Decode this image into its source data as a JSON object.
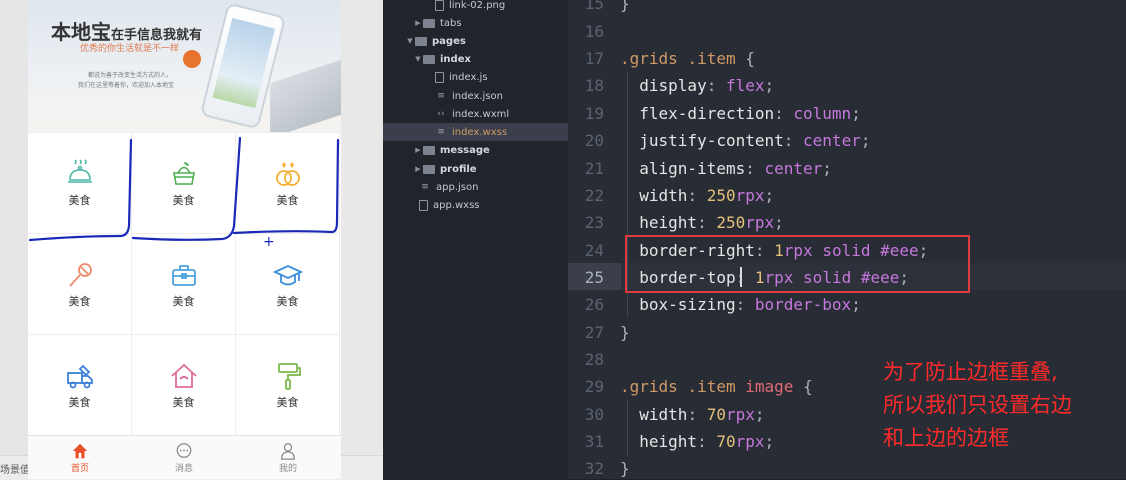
{
  "simulator": {
    "banner": {
      "title_big": "本地宝",
      "title_small": "在手信息我就有",
      "subtitle": "优秀的你生活就是不一样",
      "line1": "都说为善于改变生活方式的人，",
      "line2": "我们在这里等着你，欢迎加入本地宝"
    },
    "grid_items": [
      {
        "label": "美食",
        "icon": "food-cover-icon",
        "color": "#4fb7a8"
      },
      {
        "label": "美食",
        "icon": "basket-icon",
        "color": "#4caf50"
      },
      {
        "label": "美食",
        "icon": "rings-icon",
        "color": "#f2b134"
      },
      {
        "label": "美食",
        "icon": "microphone-icon",
        "color": "#f08a6a"
      },
      {
        "label": "美食",
        "icon": "briefcase-icon",
        "color": "#4aa3df"
      },
      {
        "label": "美食",
        "icon": "graduation-cap-icon",
        "color": "#3b8fd9"
      },
      {
        "label": "美食",
        "icon": "truck-icon",
        "color": "#3b7fd9"
      },
      {
        "label": "美食",
        "icon": "house-icon",
        "color": "#e46b9d"
      },
      {
        "label": "美食",
        "icon": "paint-roller-icon",
        "color": "#7bb84a"
      }
    ],
    "tabs": [
      {
        "label": "首页",
        "icon": "home-icon",
        "active": true
      },
      {
        "label": "消息",
        "icon": "message-icon",
        "active": false
      },
      {
        "label": "我的",
        "icon": "user-icon",
        "active": false
      }
    ],
    "status_text": "场景值",
    "annotation_mark": "+"
  },
  "file_tree": [
    {
      "name": "link-02.png",
      "type": "file-image"
    },
    {
      "name": "tabs",
      "type": "folder"
    },
    {
      "name": "pages",
      "type": "folder-open"
    },
    {
      "name": "index",
      "type": "folder-open"
    },
    {
      "name": "index.js",
      "type": "file-js"
    },
    {
      "name": "index.json",
      "type": "file-json"
    },
    {
      "name": "index.wxml",
      "type": "file-wxml"
    },
    {
      "name": "index.wxss",
      "type": "file-wxss",
      "selected": true
    },
    {
      "name": "message",
      "type": "folder"
    },
    {
      "name": "profile",
      "type": "folder"
    },
    {
      "name": "app.json",
      "type": "file-json"
    },
    {
      "name": "app.wxss",
      "type": "file"
    }
  ],
  "editor": {
    "line_numbers": [
      "15",
      "16",
      "17",
      "18",
      "19",
      "20",
      "21",
      "22",
      "23",
      "24",
      "25",
      "26",
      "27",
      "28",
      "29",
      "30",
      "31",
      "32"
    ],
    "current_line": "25",
    "tokens": {
      "l15": "}",
      "l17_sel1": ".grids",
      "l17_sel2": ".item",
      "l17_brace": "{",
      "l18_p": "display",
      "l18_v": "flex",
      "l19_p": "flex-direction",
      "l19_v": "column",
      "l20_p": "justify-content",
      "l20_v": "center",
      "l21_p": "align-items",
      "l21_v": "center",
      "l22_p": "width",
      "l22_n": "250",
      "l22_u": "rpx",
      "l23_p": "height",
      "l23_n": "250",
      "l23_u": "rpx",
      "l24_p": "border-right",
      "l24_n": "1",
      "l24_u": "rpx",
      "l24_v": "solid #eee",
      "l25_p": "border-top",
      "l25_n": "1",
      "l25_u": "rpx",
      "l25_v": "solid #eee",
      "l26_p": "box-sizing",
      "l26_v": "border-box",
      "l27": "}",
      "l29_sel1": ".grids",
      "l29_sel2": ".item",
      "l29_el": "image",
      "l29_brace": "{",
      "l30_p": "width",
      "l30_n": "70",
      "l30_u": "rpx",
      "l31_p": "height",
      "l31_n": "70",
      "l31_u": "rpx",
      "l32": "}"
    },
    "note_lines": [
      "为了防止边框重叠,",
      "所以我们只设置右边",
      "和上边的边框"
    ],
    "colors": {
      "note": "#ff2a2a",
      "box": "#e03b3b",
      "marker": "#1a2ab8"
    }
  }
}
